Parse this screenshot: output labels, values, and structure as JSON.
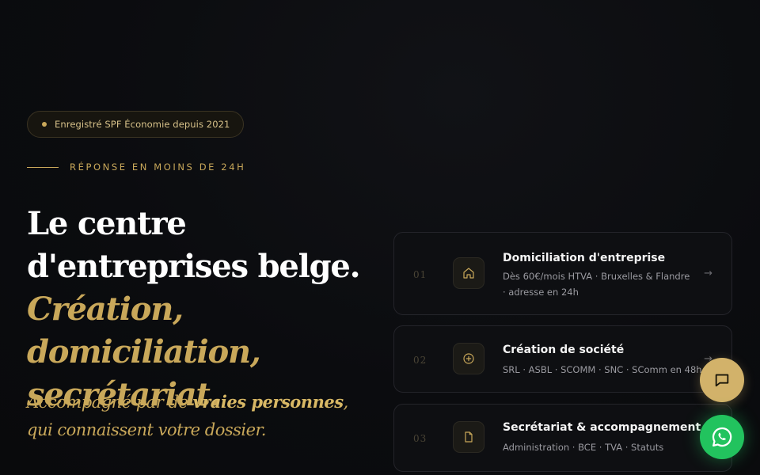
{
  "badge": {
    "text": "Enregistré SPF Économie depuis 2021"
  },
  "eyebrow": {
    "text": "RÉPONSE EN MOINS DE 24H"
  },
  "headline": {
    "line1": "Le centre",
    "line2": "d'entreprises belge.",
    "line3": "Création, domiciliation,",
    "line4": "secrétariat."
  },
  "subline": {
    "before": "Accompagné par de ",
    "emphasis": "vraies personnes",
    "after": ", qui connaissent votre dossier."
  },
  "services": [
    {
      "number": "01",
      "icon": "home-icon",
      "title": "Domiciliation d'entreprise",
      "description": "Dès 60€/mois HTVA · Bruxelles & Flandre · adresse en 24h",
      "arrow": "→"
    },
    {
      "number": "02",
      "icon": "plus-circle-icon",
      "title": "Création de société",
      "description": "SRL · ASBL · SCOMM · SNC · SComm en 48h",
      "arrow": "→"
    },
    {
      "number": "03",
      "icon": "document-icon",
      "title": "Secrétariat & accompagnement",
      "description": "Administration · BCE · TVA · Statuts",
      "arrow": "→"
    }
  ],
  "colors": {
    "gold": "#c9a85a",
    "background": "#0b0c0f",
    "whatsapp": "#22c35e"
  }
}
